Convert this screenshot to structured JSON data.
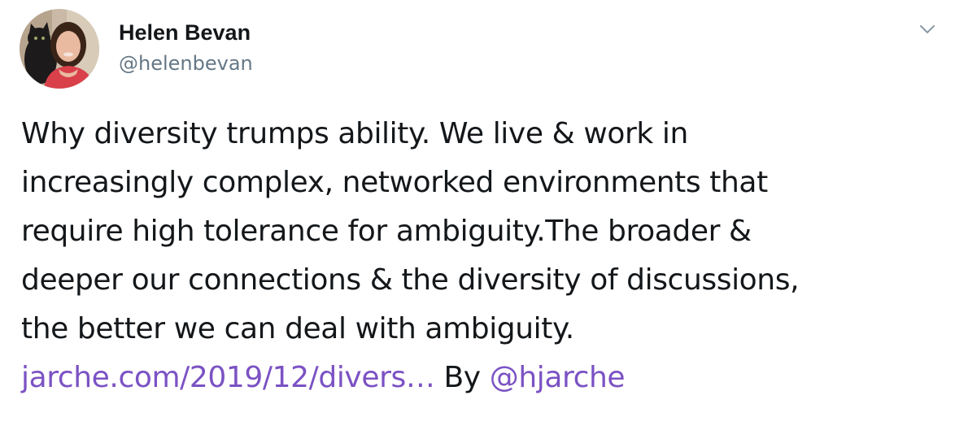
{
  "author": {
    "name": "Helen Bevan",
    "handle": "@helenbevan"
  },
  "menu_icon": "chevron-down-icon",
  "tweet": {
    "lines": [
      "Why diversity trumps ability. We live & work in",
      "increasingly complex, networked environments that",
      "require high tolerance for ambiguity.The broader &",
      "deeper our connections & the diversity of discussions,",
      "the better we can deal with ambiguity."
    ],
    "link_text": "jarche.com/2019/12/divers…",
    "by_text": "By",
    "mention": "@hjarche"
  },
  "colors": {
    "text": "#14171a",
    "secondary": "#657786",
    "link": "#7b52c4",
    "background": "#ffffff"
  }
}
